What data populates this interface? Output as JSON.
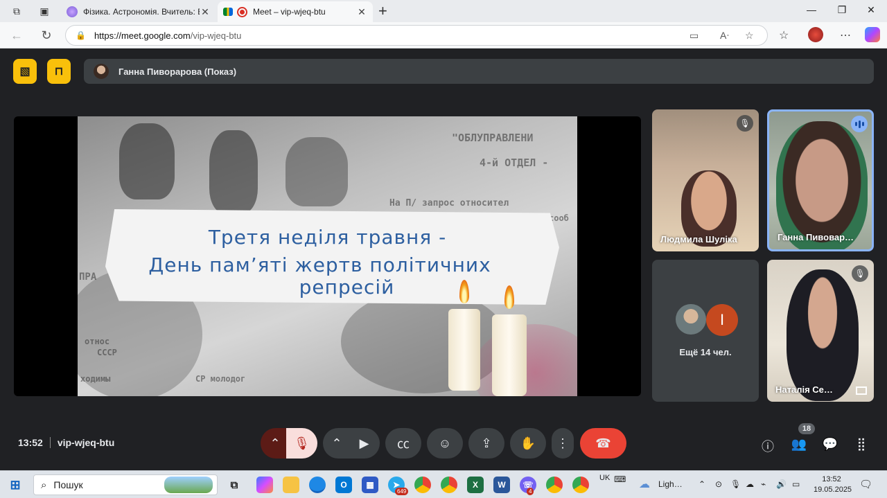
{
  "browser": {
    "tabs": [
      {
        "title": "Фізика. Астрономія. Вчитель: Бер",
        "active": false
      },
      {
        "title": "Meet – vip-wjeq-btu",
        "active": true
      }
    ],
    "url_host": "https://meet.google.com",
    "url_path": "/vip-wjeq-btu"
  },
  "meet": {
    "presenter_label": "Ганна Пиворарова (Показ)",
    "slide": {
      "line1": "Третя неділя травня -",
      "line2": "День пам’яті жертв політичних",
      "line3": "репресій",
      "doc_text": [
        "\"ОБЛУПРАВЛЕНИ",
        "4-й ОТДЕЛ -",
        "На П/ запрос относител",
        "сооб",
        "ПРА",
        "относ",
        "СССР",
        "ходимы",
        "СР молодог"
      ]
    },
    "participants": [
      {
        "name": "Людмила Шуліка",
        "muted": true
      },
      {
        "name": "Ганна Пивовар…",
        "speaking": true
      },
      {
        "name": "Ещё 14 чел.",
        "avatar_letter": "I"
      },
      {
        "name": "Наталія Се…",
        "muted": true
      }
    ],
    "time": "13:52",
    "meeting_code": "vip-wjeq-btu",
    "people_count": "18",
    "colors": {
      "accent_yellow": "#f9c00b",
      "end_call": "#ea4335",
      "mic_off": "#f9dedc"
    }
  },
  "taskbar": {
    "search_placeholder": "Пошук",
    "weather_label": "Ligh…",
    "lang": "UK",
    "time": "13:52",
    "date": "19.05.2025",
    "badges": {
      "telegram": "649",
      "viber": "4"
    }
  }
}
